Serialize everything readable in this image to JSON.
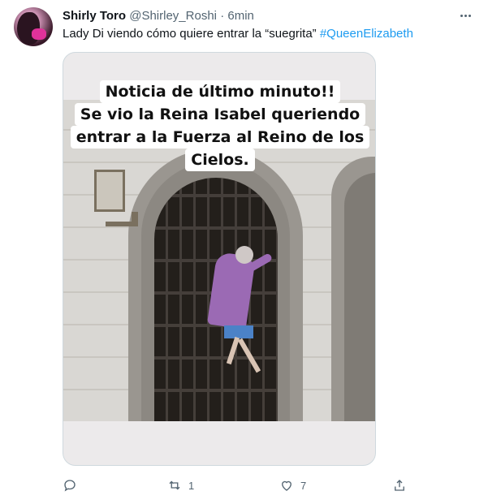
{
  "tweet": {
    "author_name": "Shirly Toro",
    "author_handle": "@Shirley_Roshi",
    "separator": "·",
    "time": "6min",
    "text": "Lady Di viendo cómo quiere entrar la “suegrita” ",
    "hashtag": "#QueenElizabeth"
  },
  "media": {
    "caption_lines": [
      "Noticia de último minuto!!",
      "Se vio la Reina Isabel queriendo",
      "entrar a la Fuerza al Reino de los",
      "Cielos."
    ]
  },
  "actions": {
    "reply_count": "",
    "retweet_count": "1",
    "like_count": "7"
  },
  "icons": [
    "more-icon",
    "reply-icon",
    "retweet-icon",
    "like-icon",
    "share-icon"
  ],
  "colors": {
    "accent": "#1d9bf0",
    "secondary_text": "#536471",
    "border": "#cfd9de"
  }
}
